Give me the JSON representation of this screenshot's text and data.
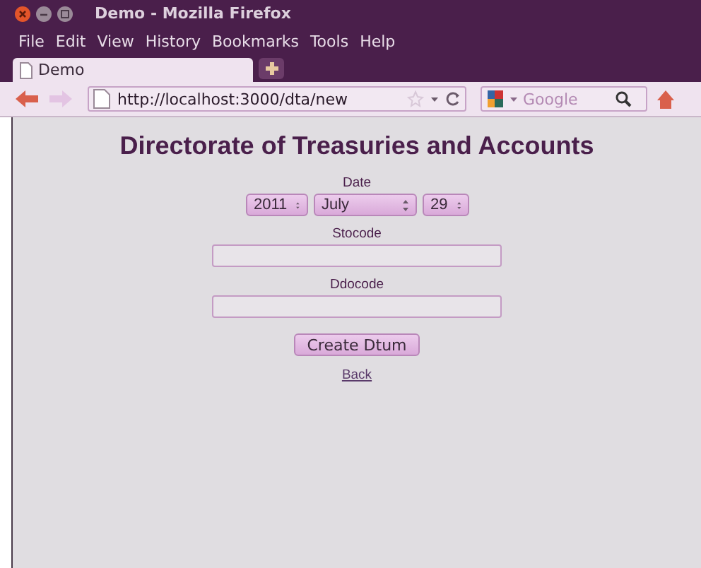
{
  "window": {
    "title": "Demo - Mozilla Firefox"
  },
  "menu": [
    "File",
    "Edit",
    "View",
    "History",
    "Bookmarks",
    "Tools",
    "Help"
  ],
  "tabs": [
    {
      "label": "Demo",
      "selected": true
    }
  ],
  "address_bar": {
    "url": "http://localhost:3000/dta/new"
  },
  "search": {
    "placeholder": "Google"
  },
  "page": {
    "heading": "Directorate of Treasuries and Accounts",
    "date": {
      "label": "Date",
      "year": "2011",
      "month": "July",
      "day": "29"
    },
    "fields": [
      {
        "label": "Stocode"
      },
      {
        "label": "Ddocode"
      }
    ],
    "submit": "Create Dtum",
    "link": "Back"
  }
}
